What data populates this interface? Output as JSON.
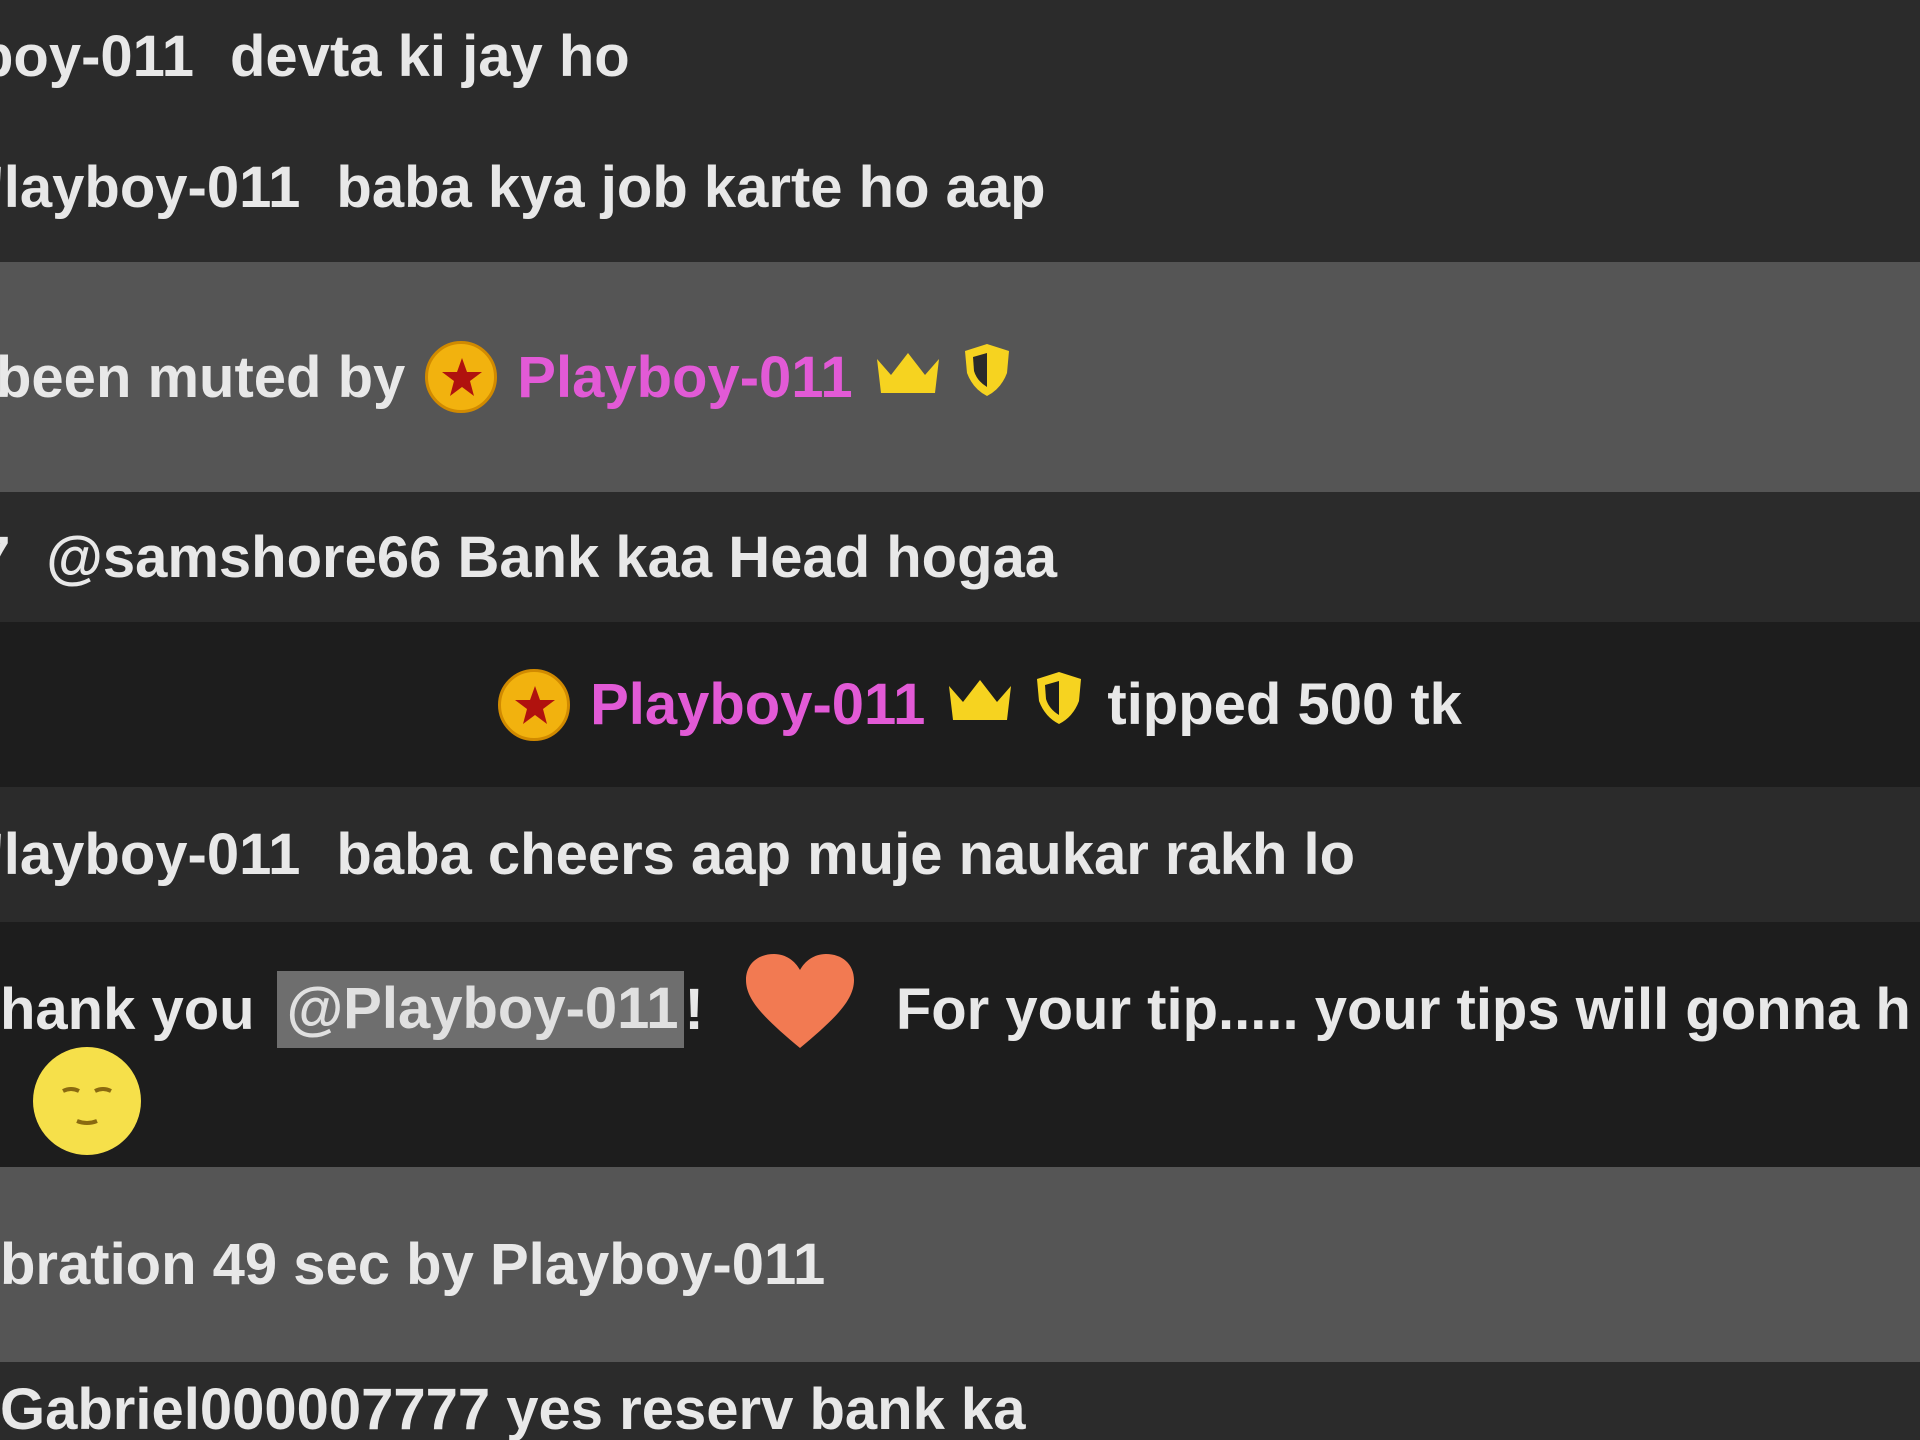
{
  "chat": {
    "messages": [
      {
        "user": "boy-011",
        "text": "devta ki jay ho"
      },
      {
        "user": "'layboy-011",
        "text": "baba kya job karte ho aap"
      },
      {
        "system_prefix": "been muted by",
        "moderator": "Playboy-011"
      },
      {
        "user": "7",
        "text": "@samshore66  Bank kaa Head hogaa"
      },
      {
        "tipper": "Playboy-011",
        "tip_text": "tipped 500 tk"
      },
      {
        "user": "'layboy-011",
        "text": "baba cheers aap muje naukar rakh lo"
      },
      {
        "prefix": "hank you",
        "mention": "@Playboy-011",
        "suffix": "!",
        "text": "For your tip..... your tips will gonna h"
      },
      {
        "text": "bration 49 sec by Playboy-011"
      },
      {
        "text": "Gabriel000007777  yes reserv bank ka"
      }
    ]
  },
  "colors": {
    "username_pink": "#e25ad6",
    "badge_gold": "#f2b20e",
    "crown_yellow": "#f6d320",
    "heart": "#f27a52",
    "star_red": "#b0120e"
  },
  "icons": {
    "badge": "star-badge-icon",
    "crown": "crown-icon",
    "shield": "shield-icon",
    "heart": "heart-icon",
    "emoji": "relieved-face-icon"
  }
}
